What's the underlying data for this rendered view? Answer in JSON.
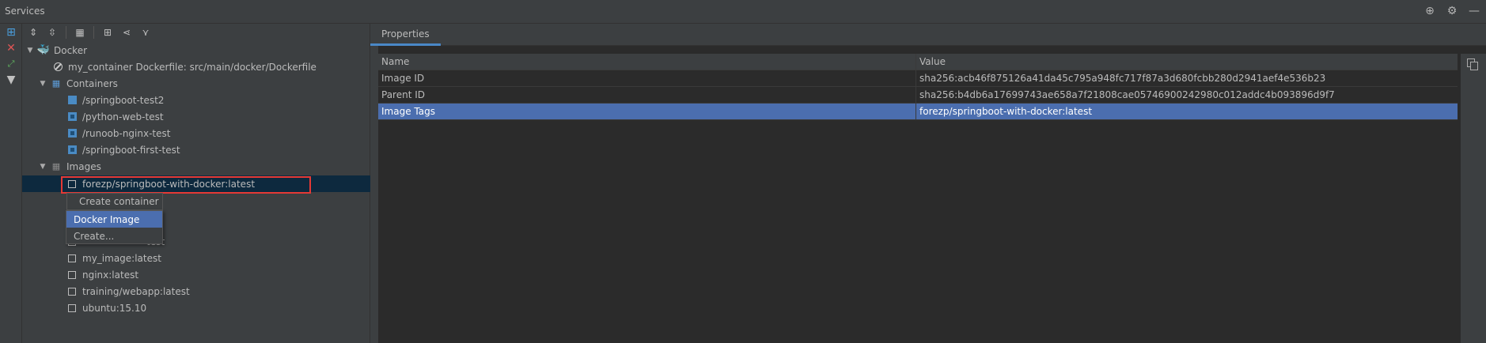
{
  "window": {
    "title": "Services"
  },
  "title_icons": [
    "crosshair-icon",
    "gear-icon",
    "minimize-icon"
  ],
  "tree": {
    "root": "Docker",
    "my_container": "my_container Dockerfile: src/main/docker/Dockerfile",
    "containers_label": "Containers",
    "containers": [
      "/springboot-test2",
      "/python-web-test",
      "/runoob-nginx-test",
      "/springboot-first-test"
    ],
    "images_label": "Images",
    "images": [
      "forezp/springboot-with-docker:latest",
      "",
      "",
      "test",
      "my_image:latest",
      "nginx:latest",
      "training/webapp:latest",
      "ubuntu:15.10"
    ]
  },
  "context_menu": {
    "header": "Create container",
    "items": [
      "Docker Image",
      "Create..."
    ]
  },
  "properties": {
    "tab": "Properties",
    "headers": {
      "name": "Name",
      "value": "Value"
    },
    "rows": [
      {
        "name": "Image ID",
        "value": "sha256:acb46f875126a41da45c795a948fc717f87a3d680fcbb280d2941aef4e536b23"
      },
      {
        "name": "Parent ID",
        "value": "sha256:b4db6a17699743ae658a7f21808cae05746900242980c012addc4b093896d9f7"
      },
      {
        "name": "Image Tags",
        "value": "forezp/springboot-with-docker:latest"
      }
    ]
  },
  "colors": {
    "selection": "#4b6eaf",
    "tree_selection": "#0d293e",
    "highlight_border": "#e53935",
    "accent": "#4a88c7"
  }
}
